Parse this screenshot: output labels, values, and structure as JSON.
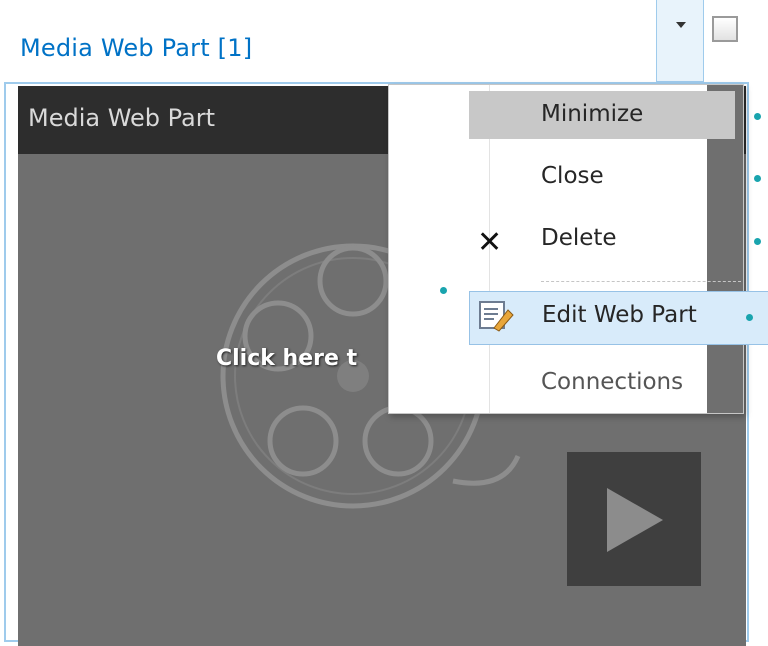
{
  "webpart": {
    "title": "Media Web Part [1]"
  },
  "media": {
    "header": "Media Web Part",
    "overlay_text": "Click here t",
    "icons": {
      "reel": "film-reel-icon",
      "play": "play-icon"
    }
  },
  "menu": {
    "items": [
      {
        "label": "Minimize",
        "icon": ""
      },
      {
        "label": "Close",
        "icon": ""
      },
      {
        "label": "Delete",
        "icon": "x-icon"
      },
      {
        "label": "Edit Web Part",
        "icon": "edit-icon"
      },
      {
        "label": "Connections",
        "icon": ""
      }
    ]
  },
  "colors": {
    "title_blue": "#0072c6",
    "selection_blue": "#d8ebfa",
    "accent_teal": "#19a4ae"
  }
}
